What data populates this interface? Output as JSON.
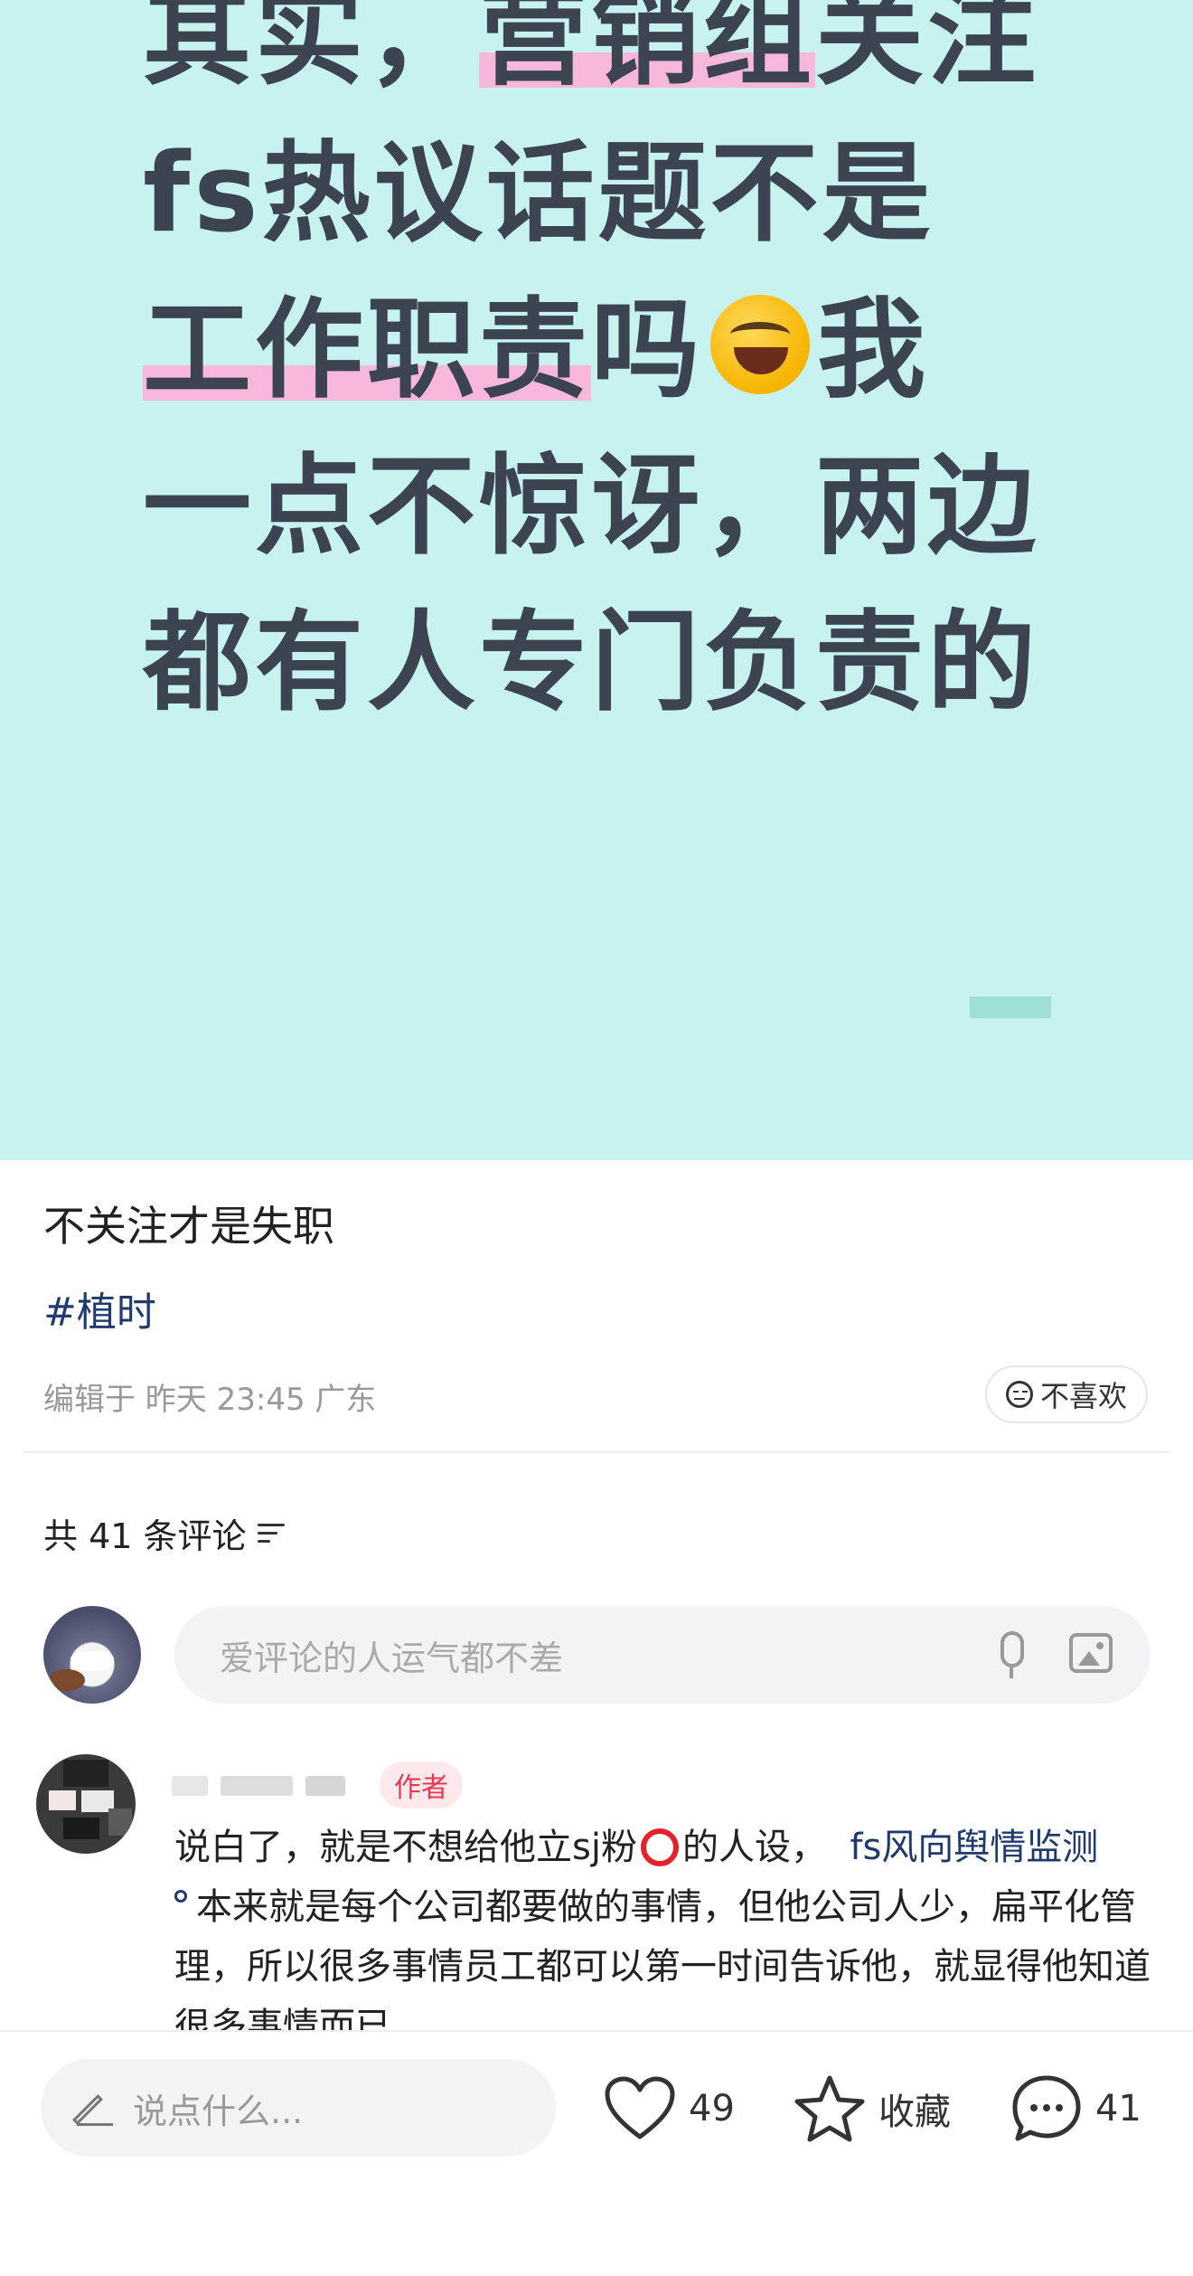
{
  "hero": {
    "lines": [
      "其实，营销组关注",
      "fs热议话题不是",
      "工作职责吗",
      "我",
      "一点不惊讶，两边",
      "都有人专门负责的"
    ],
    "highlights": [
      "营销组",
      "工作职责"
    ]
  },
  "post": {
    "title": "不关注才是失职",
    "tag": "#植时",
    "meta": "编辑于 昨天 23:45 广东",
    "dislike_label": "不喜欢"
  },
  "comments": {
    "count_label": "共 41 条评论",
    "input_placeholder": "爱评论的人运气都不差",
    "first": {
      "badge": "作者",
      "text_before_ring": "说白了，就是不想给他立sj粉",
      "text_after_ring": "的人设，",
      "link_text": "fs风向舆情监测",
      "text_after_link": "本来就是每个公司都要做的事情，但他公司人少，扁平化管理，所以很多事情员工都可以第一时间告诉他，就显得他知道很多事情而已"
    }
  },
  "bottom_bar": {
    "say_placeholder": "说点什么...",
    "likes": "49",
    "collect_label": "收藏",
    "comments": "41"
  },
  "colors": {
    "hero_bg": "#c8f2ef",
    "highlight": "#f7b8dc",
    "link": "#1e3a6e",
    "author_badge": "#e8384f"
  }
}
